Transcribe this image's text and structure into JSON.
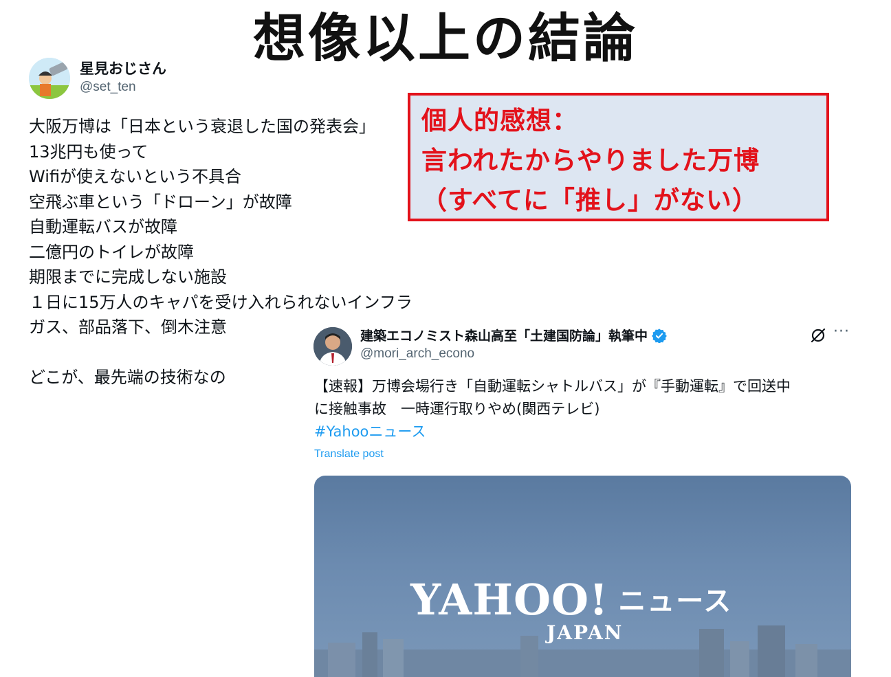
{
  "slide": {
    "title": "想像以上の結論"
  },
  "callout": {
    "lines": [
      "個人的感想：",
      "言われたからやりました万博",
      "（すべてに「推し」がない）"
    ]
  },
  "tweet1": {
    "display_name": "星見おじさん",
    "handle": "@set_ten",
    "lines": [
      "大阪万博は「日本という衰退した国の発表会」",
      "13兆円も使って",
      "Wifiが使えないという不具合",
      "空飛ぶ車という「ドローン」が故障",
      "自動運転バスが故障",
      "二億円のトイレが故障",
      "期限までに完成しない施設",
      "１日に15万人のキャパを受け入れられないインフラ",
      "ガス、部品落下、倒木注意",
      "",
      "どこが、最先端の技術なの"
    ]
  },
  "tweet2": {
    "display_name": "建築エコノミスト森山高至「土建国防論」執筆中",
    "handle": "@mori_arch_econo",
    "more_label": "···",
    "text_line1": "【速報】万博会場行き「自動運転シャトルバス」が『手動運転』で回送中",
    "text_line2": "に接触事故　一時運行取りやめ(関西テレビ)",
    "hashtag": "#Yahooニュース",
    "translate_label": "Translate post",
    "card": {
      "logo_word": "YAHOO!",
      "logo_news": "ニュース",
      "logo_sub": "JAPAN"
    }
  },
  "colors": {
    "accent_red": "#e3121b",
    "callout_bg": "#dde6f2",
    "link_blue": "#1d9bf0",
    "muted_text": "#536471"
  },
  "icons": [
    "verified-badge-icon",
    "grok-icon",
    "more-options-icon"
  ]
}
